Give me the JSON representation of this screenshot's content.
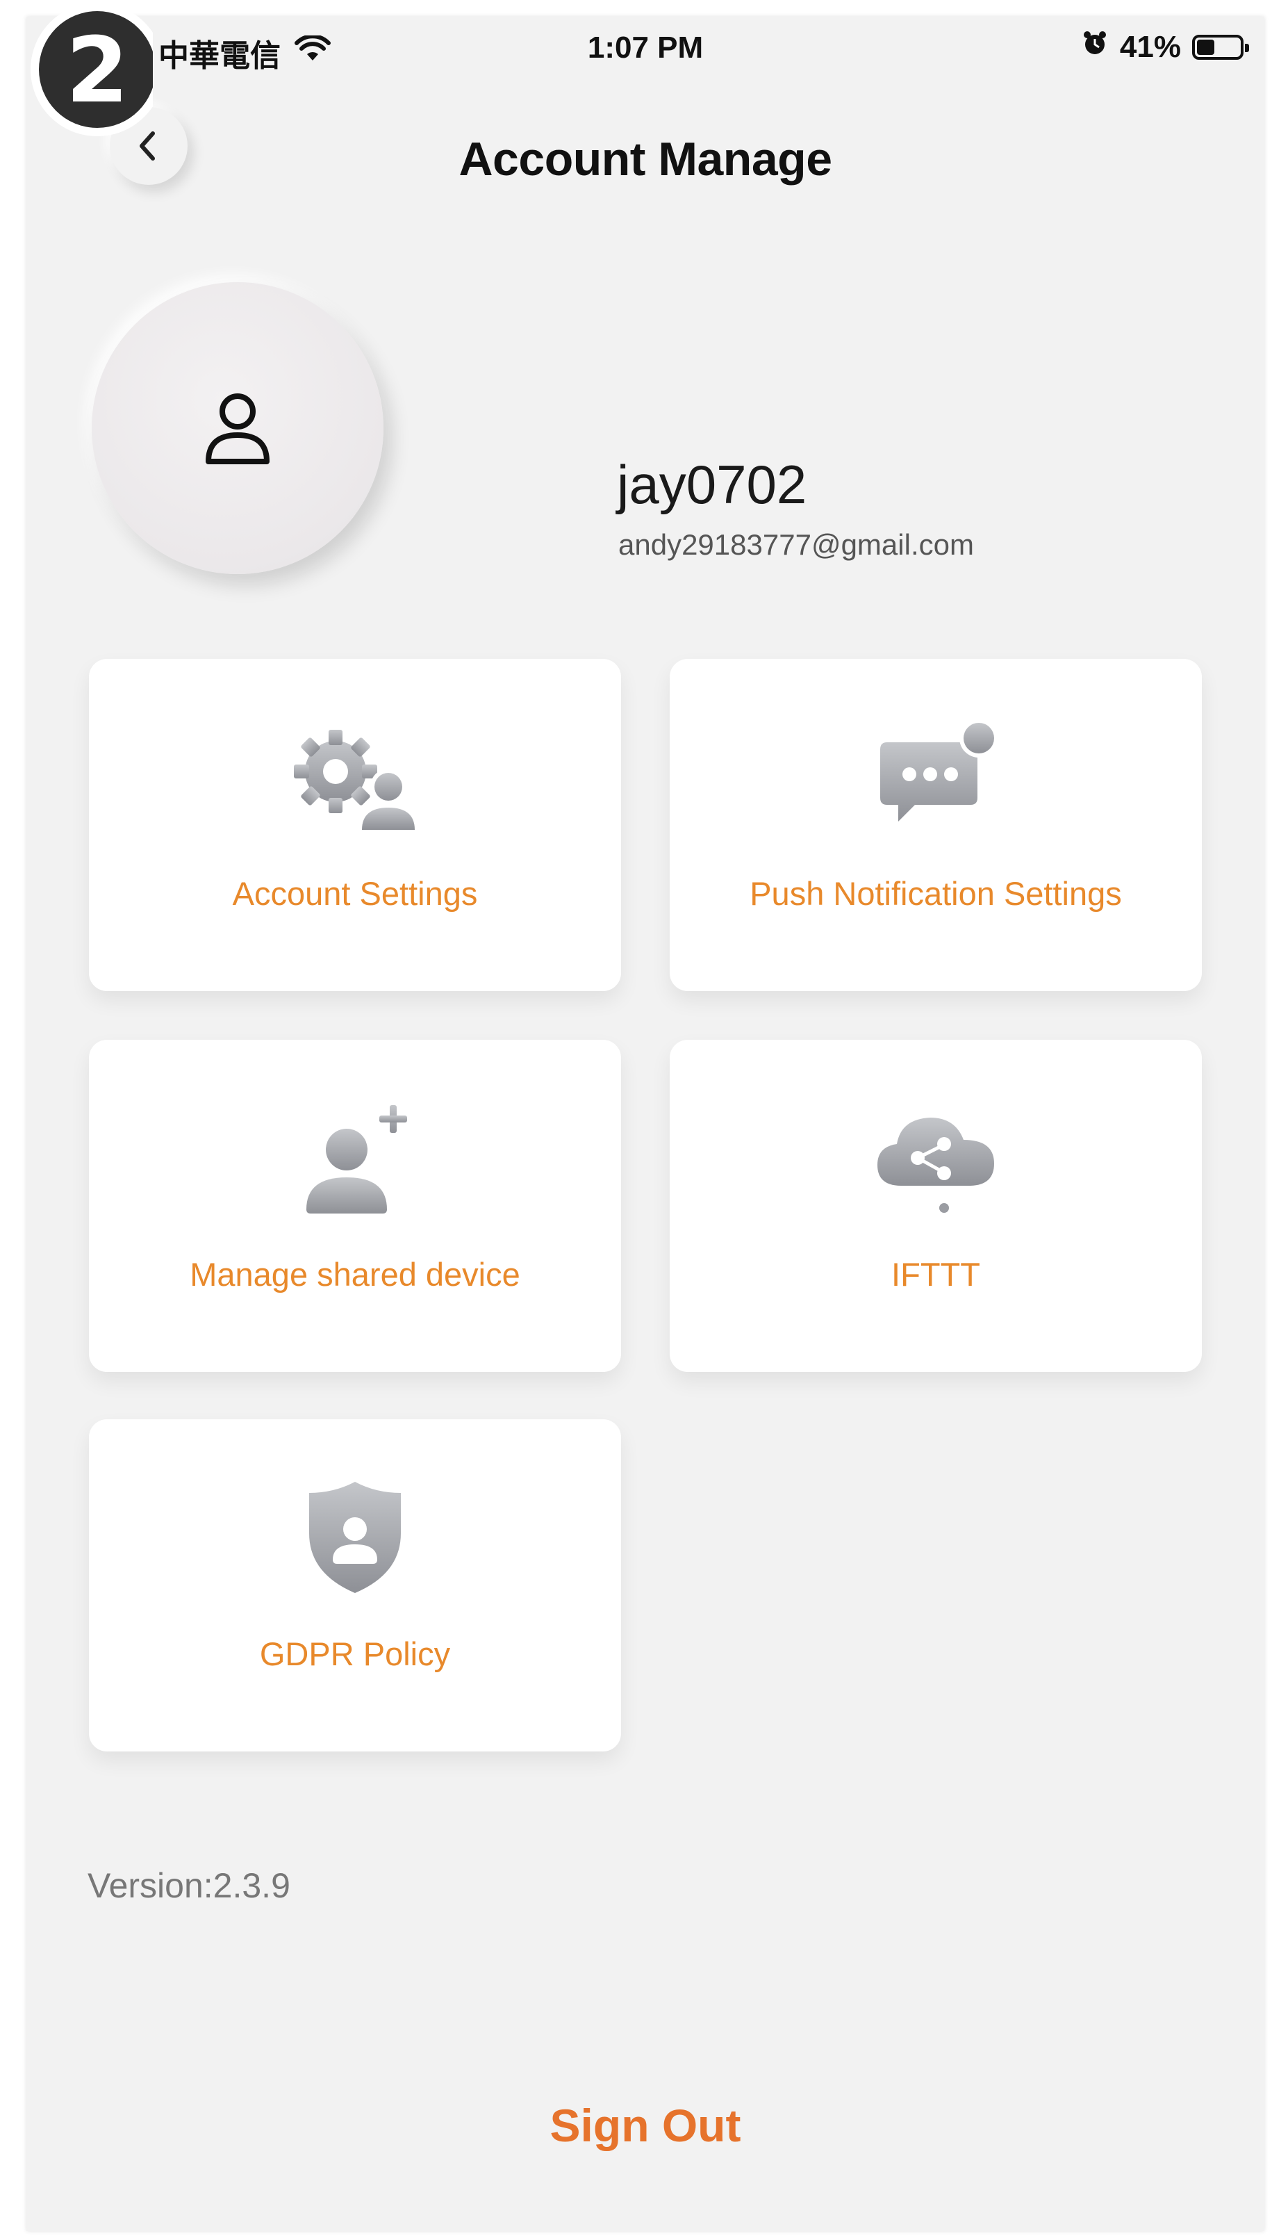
{
  "status_bar": {
    "carrier": "中華電信",
    "time": "1:07 PM",
    "battery_percent": "41%",
    "battery_level": 0.41,
    "icons": [
      "wifi-icon",
      "alarm-icon",
      "battery-icon"
    ]
  },
  "step_badge": {
    "number": "2"
  },
  "header": {
    "title": "Account Manage",
    "back_icon": "chevron-left-icon"
  },
  "profile": {
    "avatar_icon": "user-outline-icon",
    "username": "jay0702",
    "email": "andy29183777@gmail.com"
  },
  "tiles": [
    {
      "label": "Account Settings",
      "icon": "gear-user-icon"
    },
    {
      "label": "Push Notification Settings",
      "icon": "chat-notification-icon"
    },
    {
      "label": "Manage shared device",
      "icon": "add-user-icon"
    },
    {
      "label": "IFTTT",
      "icon": "cloud-share-icon"
    },
    {
      "label": "GDPR Policy",
      "icon": "shield-user-icon"
    }
  ],
  "footer": {
    "version": "Version:2.3.9",
    "sign_out_label": "Sign Out"
  },
  "colors": {
    "accent": "#e8892b",
    "sign_out": "#e6732c",
    "background": "#f2f2f2",
    "tile": "#ffffff",
    "icon_gray": "#a3a5aa"
  }
}
